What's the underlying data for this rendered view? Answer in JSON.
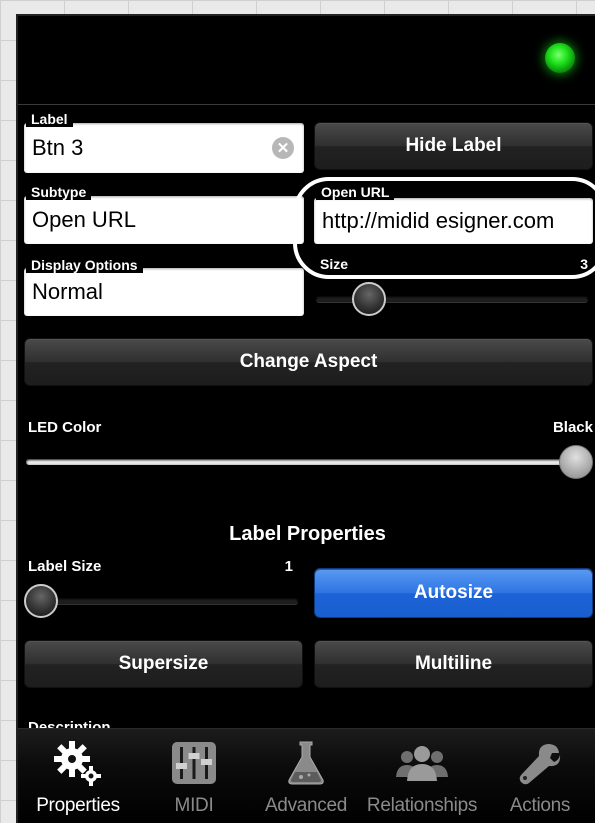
{
  "properties": {
    "label": {
      "title": "Label",
      "value": "Btn 3"
    },
    "hide_label_button": "Hide Label",
    "subtype": {
      "title": "Subtype",
      "value": "Open URL"
    },
    "open_url": {
      "title": "Open URL",
      "value": "http://midid esigner.com"
    },
    "display_options": {
      "title": "Display Options",
      "value": "Normal"
    },
    "size": {
      "title": "Size",
      "value": "3",
      "level": 0.18
    },
    "change_aspect_button": "Change Aspect",
    "led_color": {
      "title": "LED Color",
      "value": "Black",
      "level": 1.0
    },
    "label_properties_title": "Label Properties",
    "label_size": {
      "title": "Label Size",
      "value": "1",
      "level": 0.0
    },
    "autosize_button": "Autosize",
    "supersize_button": "Supersize",
    "multiline_button": "Multiline",
    "partial_next_label": "Description"
  },
  "tabs": [
    {
      "label": "Properties",
      "icon": "gears-icon",
      "active": true
    },
    {
      "label": "MIDI",
      "icon": "mixer-sliders-icon",
      "active": false
    },
    {
      "label": "Advanced",
      "icon": "flask-icon",
      "active": false
    },
    {
      "label": "Relationships",
      "icon": "people-group-icon",
      "active": false
    },
    {
      "label": "Actions",
      "icon": "wrench-icon",
      "active": false
    }
  ],
  "colors": {
    "led_on": "#1fe41c",
    "accent_blue": "#2e74e3",
    "panel_bg": "#000000"
  }
}
